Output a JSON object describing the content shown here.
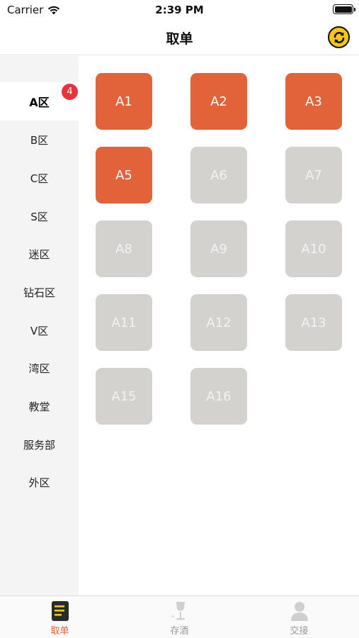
{
  "status_bar": {
    "carrier": "Carrier",
    "time": "2:39 PM"
  },
  "header": {
    "title": "取单",
    "refresh_icon": "refresh-icon"
  },
  "sidebar": {
    "items": [
      {
        "label": "A区",
        "active": true,
        "badge": "4"
      },
      {
        "label": "B区"
      },
      {
        "label": "C区"
      },
      {
        "label": "S区"
      },
      {
        "label": "迷区"
      },
      {
        "label": "钻石区"
      },
      {
        "label": "V区"
      },
      {
        "label": "湾区"
      },
      {
        "label": "教堂"
      },
      {
        "label": "服务部"
      },
      {
        "label": "外区"
      }
    ]
  },
  "tables": [
    {
      "label": "A1",
      "status": "occupied"
    },
    {
      "label": "A2",
      "status": "occupied"
    },
    {
      "label": "A3",
      "status": "occupied"
    },
    {
      "label": "A5",
      "status": "occupied"
    },
    {
      "label": "A6",
      "status": "free"
    },
    {
      "label": "A7",
      "status": "free"
    },
    {
      "label": "A8",
      "status": "free"
    },
    {
      "label": "A9",
      "status": "free"
    },
    {
      "label": "A10",
      "status": "free"
    },
    {
      "label": "A11",
      "status": "free"
    },
    {
      "label": "A12",
      "status": "free"
    },
    {
      "label": "A13",
      "status": "free"
    },
    {
      "label": "A15",
      "status": "free"
    },
    {
      "label": "A16",
      "status": "free"
    }
  ],
  "tab_bar": {
    "tabs": [
      {
        "label": "取单",
        "icon": "order-list-icon",
        "active": true
      },
      {
        "label": "存酒",
        "icon": "wine-glass-icon"
      },
      {
        "label": "交接",
        "icon": "person-icon"
      }
    ]
  },
  "colors": {
    "occupied": "#e2633a",
    "free": "#d4d2cf",
    "badge": "#e8323c",
    "accent": "#e2633a"
  }
}
